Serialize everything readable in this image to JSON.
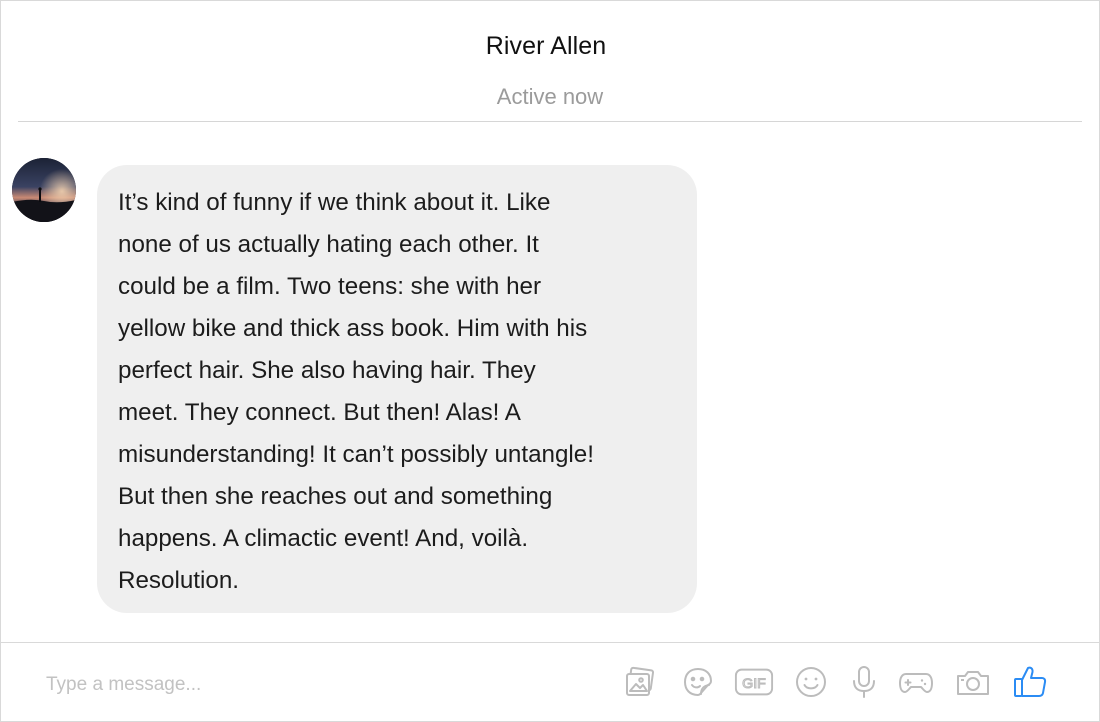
{
  "header": {
    "contact_name": "River Allen",
    "status": "Active now"
  },
  "conversation": {
    "messages": [
      {
        "sender": "River Allen",
        "avatar_icon": "avatar-sunset-silhouette",
        "text": "It’s kind of funny if we think about it. Like\nnone of us actually hating each other. It\ncould be a film. Two teens: she with her\nyellow bike and thick ass book. Him with his\nperfect hair. She also having hair. They\nmeet. They connect. But then! Alas! A\nmisunderstanding! It can’t possibly untangle!\nBut then she reaches out and something\nhappens. A climactic event! And, voilà.\nResolution."
      }
    ]
  },
  "composer": {
    "placeholder": "Type a message...",
    "value": "",
    "tools": [
      {
        "name": "image-icon",
        "label": "Photos"
      },
      {
        "name": "sticker-icon",
        "label": "Stickers"
      },
      {
        "name": "gif-icon",
        "label": "GIF"
      },
      {
        "name": "emoji-icon",
        "label": "Emoji"
      },
      {
        "name": "microphone-icon",
        "label": "Voice"
      },
      {
        "name": "game-controller-icon",
        "label": "Games"
      },
      {
        "name": "camera-icon",
        "label": "Camera"
      },
      {
        "name": "thumbs-up-icon",
        "label": "Like"
      }
    ],
    "gif_text": "GIF"
  },
  "colors": {
    "bubble_background": "#efefef",
    "status_text": "#9b9b9b",
    "icon_gray": "#bcbcbc",
    "like_blue": "#2b8cf4"
  }
}
